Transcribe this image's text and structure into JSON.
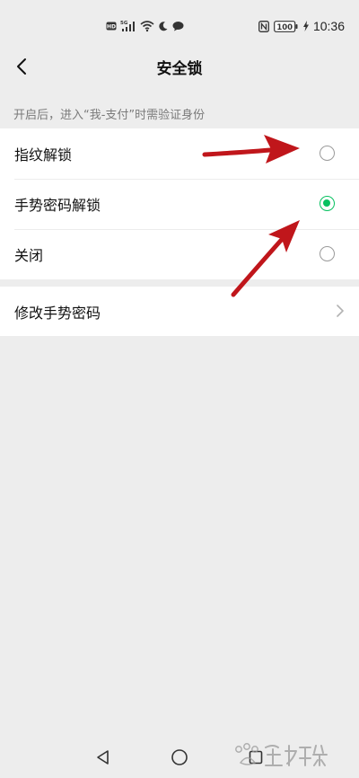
{
  "status_bar": {
    "time": "10:36",
    "battery_label": "100",
    "hd_label": "HD",
    "network_label": "5G"
  },
  "nav": {
    "title": "安全锁"
  },
  "section_hint": "开启后，进入“我-支付”时需验证身份",
  "options": [
    {
      "label": "指纹解锁",
      "selected": false
    },
    {
      "label": "手势密码解锁",
      "selected": true
    },
    {
      "label": "关闭",
      "selected": false
    }
  ],
  "modify": {
    "label": "修改手势密码"
  },
  "colors": {
    "accent": "#07c160",
    "background": "#ededed",
    "annotation_arrow": "#c0161b"
  },
  "icons": {
    "back": "back-chevron-icon",
    "chevron": "chevron-right-icon",
    "nav_back": "triangle-back-icon",
    "nav_home": "circle-home-icon",
    "nav_recent": "square-recents-icon"
  }
}
